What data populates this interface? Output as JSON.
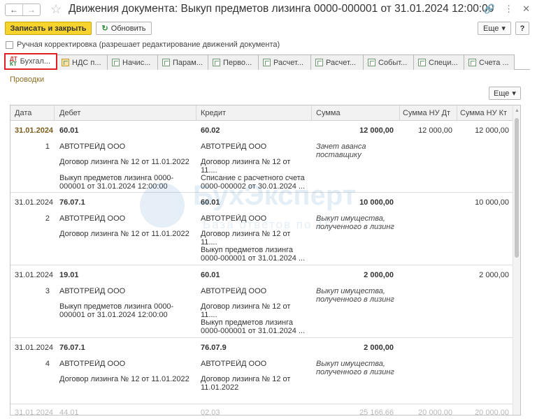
{
  "window": {
    "title": "Движения документа: Выкуп предметов лизинга 0000-000001 от 31.01.2024 12:00:00"
  },
  "toolbar": {
    "save_close": "Записать и закрыть",
    "refresh": "Обновить",
    "more": "Еще",
    "help": "?"
  },
  "manual_edit": {
    "label": "Ручная корректировка (разрешает редактирование движений документа)"
  },
  "tabs": [
    {
      "label": "Бухгал...",
      "active": true
    },
    {
      "label": "НДС п..."
    },
    {
      "label": "Начис..."
    },
    {
      "label": "Парам..."
    },
    {
      "label": "Перво..."
    },
    {
      "label": "Расчет..."
    },
    {
      "label": "Расчет..."
    },
    {
      "label": "Событ..."
    },
    {
      "label": "Специ..."
    },
    {
      "label": "Счета ..."
    }
  ],
  "section": {
    "label": "Проводки",
    "more": "Еще"
  },
  "table": {
    "columns": {
      "date": "Дата",
      "debit": "Дебет",
      "credit": "Кредит",
      "sum": "Сумма",
      "sum_nu_dt": "Сумма НУ Дт",
      "sum_nu_kt": "Сумма НУ Кт"
    },
    "rows": [
      {
        "date": "31.01.2024",
        "num": "1",
        "debit_account": "60.01",
        "debit_sub1": "АВТОТРЕЙД ООО",
        "debit_sub2": "Договор лизинга № 12 от 11.01.2022",
        "debit_sub3": "Выкуп предметов лизинга 0000-000001 от 31.01.2024 12:00:00",
        "credit_account": "60.02",
        "credit_sub1": "АВТОТРЕЙД ООО",
        "credit_sub2": "Договор лизинга № 12 от 11....",
        "credit_sub3": "Списание с расчетного счета 0000-000002 от 30.01.2024 ...",
        "sum": "12 000,00",
        "content": "Зачет аванса поставщику",
        "sum_nu_dt": "12 000,00",
        "sum_nu_kt": "12 000,00"
      },
      {
        "date": "31.01.2024",
        "num": "2",
        "debit_account": "76.07.1",
        "debit_sub1": "АВТОТРЕЙД ООО",
        "debit_sub2": "Договор лизинга № 12 от 11.01.2022",
        "debit_sub3": "",
        "credit_account": "60.01",
        "credit_sub1": "АВТОТРЕЙД ООО",
        "credit_sub2": "Договор лизинга № 12 от 11....",
        "credit_sub3": "Выкуп предметов лизинга 0000-000001 от 31.01.2024 ...",
        "sum": "10 000,00",
        "content": "Выкуп имущества, полученного в лизинг",
        "sum_nu_dt": "",
        "sum_nu_kt": "10 000,00"
      },
      {
        "date": "31.01.2024",
        "num": "3",
        "debit_account": "19.01",
        "debit_sub1": "АВТОТРЕЙД ООО",
        "debit_sub2": "Выкуп предметов лизинга 0000-000001 от 31.01.2024 12:00:00",
        "debit_sub3": "",
        "credit_account": "60.01",
        "credit_sub1": "АВТОТРЕЙД ООО",
        "credit_sub2": "Договор лизинга № 12 от 11....",
        "credit_sub3": "Выкуп предметов лизинга 0000-000001 от 31.01.2024 ...",
        "sum": "2 000,00",
        "content": "Выкуп имущества, полученного в лизинг",
        "sum_nu_dt": "",
        "sum_nu_kt": "2 000,00"
      },
      {
        "date": "31.01.2024",
        "num": "4",
        "debit_account": "76.07.1",
        "debit_sub1": "АВТОТРЕЙД ООО",
        "debit_sub2": "Договор лизинга № 12 от 11.01.2022",
        "debit_sub3": "",
        "credit_account": "76.07.9",
        "credit_sub1": "АВТОТРЕЙД ООО",
        "credit_sub2": "Договор лизинга № 12 от 11.01.2022",
        "credit_sub3": "",
        "sum": "2 000,00",
        "content": "Выкуп имущества, полученного в лизинг",
        "sum_nu_dt": "",
        "sum_nu_kt": ""
      },
      {
        "date": "31.01.2024",
        "num": "",
        "debit_account": "44.01",
        "debit_sub1": "",
        "debit_sub2": "",
        "debit_sub3": "",
        "credit_account": "02.03",
        "credit_sub1": "",
        "credit_sub2": "",
        "credit_sub3": "",
        "sum": "25 166,66",
        "content": "",
        "sum_nu_dt": "20 000,00",
        "sum_nu_kt": "20 000,00"
      }
    ]
  },
  "watermark": {
    "title": "БухЭксперт",
    "subtitle": "База ответов по 1С"
  }
}
